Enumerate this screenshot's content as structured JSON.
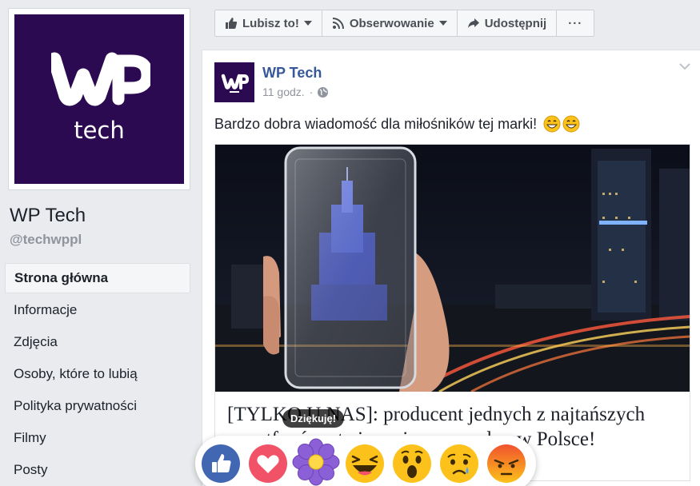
{
  "page": {
    "name": "WP Tech",
    "handle": "@techwppl",
    "logo_text": "WP",
    "logo_subtext": "tech"
  },
  "nav": {
    "items": [
      {
        "label": "Strona główna",
        "active": true
      },
      {
        "label": "Informacje"
      },
      {
        "label": "Zdjęcia"
      },
      {
        "label": "Osoby, które to lubią"
      },
      {
        "label": "Polityka prywatności"
      },
      {
        "label": "Filmy"
      },
      {
        "label": "Posty"
      }
    ]
  },
  "actions": {
    "like_label": "Lubisz to!",
    "follow_label": "Obserwowanie",
    "share_label": "Udostępnij",
    "more_label": "···"
  },
  "post": {
    "author": "WP Tech",
    "time": "11 godz.",
    "meta_separator": "·",
    "text": "Bardzo dobra wiadomość dla miłośników tej marki!",
    "link_title": "[TYLKO U NAS]: producent jednych z najtańszych smartfonów otwiera pierwszy salon w Polsce!"
  },
  "reactions": {
    "tooltip": "Dziękuję!",
    "items": [
      "like",
      "love",
      "thankful",
      "haha",
      "wow",
      "sad",
      "angry"
    ]
  },
  "colors": {
    "brand": "#2b0a52",
    "link": "#365899",
    "like_blue": "#4267b2",
    "love_red": "#f25268",
    "thankful_purple": "#8b5fd6"
  }
}
